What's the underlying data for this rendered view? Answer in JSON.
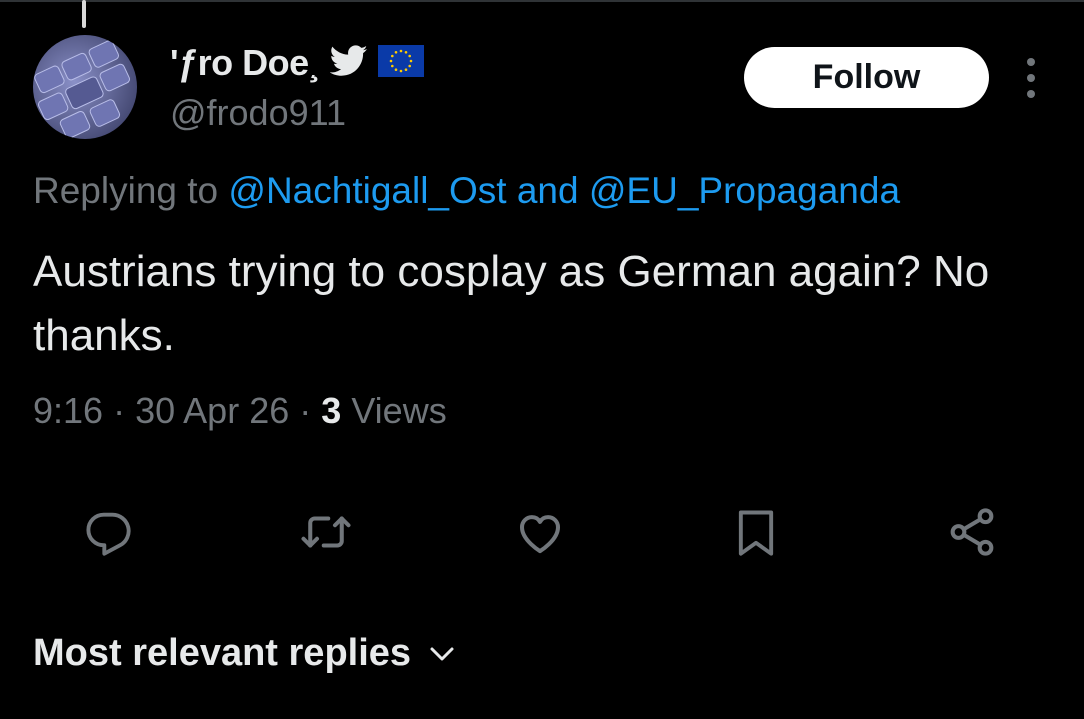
{
  "tweet": {
    "display_name": "ʹƒro Doe¸",
    "handle": "@frodo911",
    "follow_label": "Follow",
    "replying_prefix": "Replying to",
    "reply_mention_1": "@Nachtigall_Ost",
    "reply_joiner": "and",
    "reply_mention_2": "@EU_Propaganda",
    "text": "Austrians trying to cosplay as German again? No thanks.",
    "time": "9:16",
    "date": "30 Apr 26",
    "view_count": "3",
    "views_label": "Views"
  },
  "actions": {
    "icons": [
      "reply-icon",
      "retweet-icon",
      "like-icon",
      "bookmark-icon",
      "share-icon"
    ]
  },
  "replies": {
    "sort_label": "Most relevant replies"
  },
  "colors": {
    "background": "#000000",
    "accent": "#1d9bf0",
    "muted": "#71767b",
    "text": "#e7e9ea",
    "eu_flag": "#0a3aa8"
  }
}
